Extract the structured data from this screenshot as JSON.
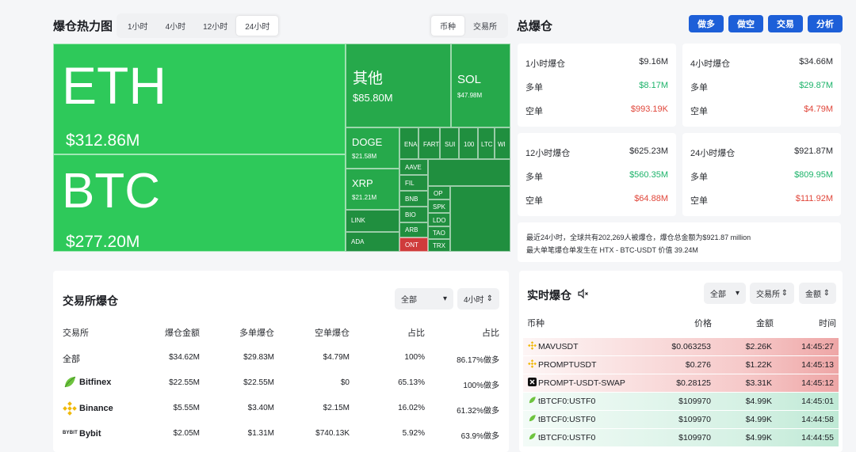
{
  "heatmap": {
    "title": "爆仓热力图",
    "ranges": [
      "1小时",
      "4小时",
      "12小时",
      "24小时"
    ],
    "active_range": "24小时",
    "group_toggle": [
      "币种",
      "交易所"
    ],
    "cells": {
      "eth": {
        "name": "ETH",
        "value": "$312.86M"
      },
      "btc": {
        "name": "BTC",
        "value": "$277.20M"
      },
      "other": {
        "name": "其他",
        "value": "$85.80M"
      },
      "sol": {
        "name": "SOL",
        "value": "$47.98M"
      },
      "doge": {
        "name": "DOGE",
        "value": "$21.58M"
      },
      "xrp": {
        "name": "XRP",
        "value": "$21.21M"
      },
      "link": {
        "name": "LINK"
      },
      "ada": {
        "name": "ADA"
      },
      "ena": {
        "name": "ENA"
      },
      "fart": {
        "name": "FART"
      },
      "sui": {
        "name": "SUI"
      },
      "s100": {
        "name": "100"
      },
      "ltc": {
        "name": "LTC"
      },
      "wi": {
        "name": "WI"
      },
      "aave": {
        "name": "AAVE"
      },
      "fil": {
        "name": "FIL"
      },
      "bnb": {
        "name": "BNB"
      },
      "bio": {
        "name": "BIO"
      },
      "arb": {
        "name": "ARB"
      },
      "ont": {
        "name": "ONT"
      },
      "op": {
        "name": "OP"
      },
      "spk": {
        "name": "SPK"
      },
      "ldo": {
        "name": "LDO"
      },
      "tao": {
        "name": "TAO"
      },
      "trx": {
        "name": "TRX"
      }
    }
  },
  "total": {
    "title": "总爆仓",
    "actions": [
      "做多",
      "做空",
      "交易",
      "分析"
    ],
    "cards": [
      {
        "label": "1小时爆仓",
        "total": "$9.16M",
        "long_label": "多单",
        "long": "$8.17M",
        "short_label": "空单",
        "short": "$993.19K"
      },
      {
        "label": "4小时爆仓",
        "total": "$34.66M",
        "long_label": "多单",
        "long": "$29.87M",
        "short_label": "空单",
        "short": "$4.79M"
      },
      {
        "label": "12小时爆仓",
        "total": "$625.23M",
        "long_label": "多单",
        "long": "$560.35M",
        "short_label": "空单",
        "short": "$64.88M"
      },
      {
        "label": "24小时爆仓",
        "total": "$921.87M",
        "long_label": "多单",
        "long": "$809.95M",
        "short_label": "空单",
        "short": "$111.92M"
      }
    ],
    "summary_line1": "最近24小时，全球共有202,269人被爆仓，爆仓总金额为$921.87 million",
    "summary_line2": "最大单笔爆仓单发生在 HTX - BTC-USDT 价值 39.24M"
  },
  "exchange": {
    "title": "交易所爆仓",
    "filter": "全部",
    "range": "4小时",
    "headers": [
      "交易所",
      "爆仓金额",
      "多单爆仓",
      "空单爆仓",
      "占比",
      "占比"
    ],
    "rows": [
      {
        "name": "全部",
        "amount": "$34.62M",
        "long": "$29.83M",
        "short": "$4.79M",
        "share": "100%",
        "ratio": "86.17%做多"
      },
      {
        "name": "Bitfinex",
        "amount": "$22.55M",
        "long": "$22.55M",
        "short": "$0",
        "share": "65.13%",
        "ratio": "100%做多"
      },
      {
        "name": "Binance",
        "amount": "$5.55M",
        "long": "$3.40M",
        "short": "$2.15M",
        "share": "16.02%",
        "ratio": "61.32%做多"
      },
      {
        "name": "Bybit",
        "amount": "$2.05M",
        "long": "$1.31M",
        "short": "$740.13K",
        "share": "5.92%",
        "ratio": "63.9%做多"
      }
    ],
    "bybit_logo_text": "BYBIT"
  },
  "realtime": {
    "title": "实时爆仓",
    "filter": "全部",
    "exchange_filter": "交易所",
    "amount_filter": "金额",
    "headers": [
      "币种",
      "价格",
      "金额",
      "时间"
    ],
    "rows": [
      {
        "symbol": "MAVUSDT",
        "price": "$0.063253",
        "amount": "$2.26K",
        "time": "14:45:27",
        "side": "long"
      },
      {
        "symbol": "PROMPTUSDT",
        "price": "$0.276",
        "amount": "$1.22K",
        "time": "14:45:13",
        "side": "long"
      },
      {
        "symbol": "PROMPT-USDT-SWAP",
        "price": "$0.28125",
        "amount": "$3.31K",
        "time": "14:45:12",
        "side": "long"
      },
      {
        "symbol": "tBTCF0:USTF0",
        "price": "$109970",
        "amount": "$4.99K",
        "time": "14:45:01",
        "side": "short"
      },
      {
        "symbol": "tBTCF0:USTF0",
        "price": "$109970",
        "amount": "$4.99K",
        "time": "14:44:58",
        "side": "short"
      },
      {
        "symbol": "tBTCF0:USTF0",
        "price": "$109970",
        "amount": "$4.99K",
        "time": "14:44:55",
        "side": "short"
      }
    ]
  },
  "colors": {
    "accent_blue": "#1d5fd8",
    "green": "#1cb36a",
    "red": "#e0463a",
    "heat_green": "#2ec95a"
  }
}
